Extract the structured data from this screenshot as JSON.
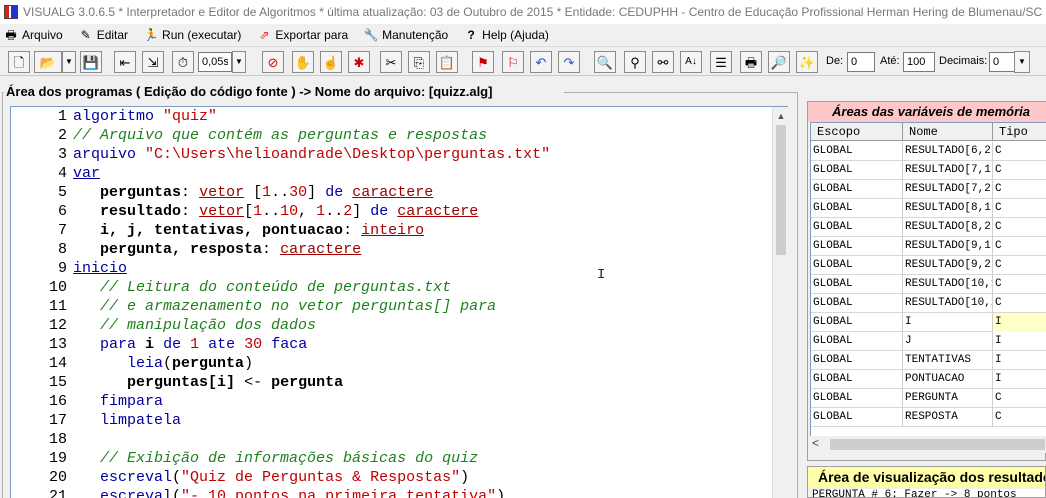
{
  "window": {
    "title": "VISUALG 3.0.6.5 * Interpretador e Editor de Algoritmos * última atualização: 03 de Outubro de 2015 * Entidade: CEDUPHH - Centro de Educação Profissional Herman Hering de Blumenau/SC"
  },
  "menu": [
    {
      "label": "Arquivo",
      "icon": "printer-icon"
    },
    {
      "label": "Editar",
      "icon": "pencil-icon"
    },
    {
      "label": "Run (executar)",
      "icon": "runner-icon"
    },
    {
      "label": "Exportar para",
      "icon": "export-icon"
    },
    {
      "label": "Manutenção",
      "icon": "wrench-icon"
    },
    {
      "label": "Help (Ajuda)",
      "icon": "question-icon"
    }
  ],
  "toolbar": {
    "speed_value": "0,05s",
    "de_label": "De:",
    "de_value": "0",
    "ate_label": "Até:",
    "ate_value": "100",
    "decimais_label": "Decimais:",
    "decimais_value": "0"
  },
  "editor": {
    "header": "Área dos programas ( Edição do código fonte ) -> Nome do arquivo: [quizz.alg]"
  },
  "variables": {
    "title": "Áreas das variáveis de memória",
    "columns": [
      "Escopo",
      "Nome",
      "Tipo"
    ],
    "rows": [
      [
        "GLOBAL",
        "RESULTADO[6,2]",
        "C"
      ],
      [
        "GLOBAL",
        "RESULTADO[7,1]",
        "C"
      ],
      [
        "GLOBAL",
        "RESULTADO[7,2]",
        "C"
      ],
      [
        "GLOBAL",
        "RESULTADO[8,1]",
        "C"
      ],
      [
        "GLOBAL",
        "RESULTADO[8,2]",
        "C"
      ],
      [
        "GLOBAL",
        "RESULTADO[9,1]",
        "C"
      ],
      [
        "GLOBAL",
        "RESULTADO[9,2]",
        "C"
      ],
      [
        "GLOBAL",
        "RESULTADO[10,1]",
        "C"
      ],
      [
        "GLOBAL",
        "RESULTADO[10,2]",
        "C"
      ],
      [
        "GLOBAL",
        "I",
        "I"
      ],
      [
        "GLOBAL",
        "J",
        "I"
      ],
      [
        "GLOBAL",
        "TENTATIVAS",
        "I"
      ],
      [
        "GLOBAL",
        "PONTUACAO",
        "I"
      ],
      [
        "GLOBAL",
        "PERGUNTA",
        "C"
      ],
      [
        "GLOBAL",
        "RESPOSTA",
        "C"
      ]
    ]
  },
  "output": {
    "title": "Área de visualização dos resultados",
    "text": "PERGUNTA # 6: Fazer -> 8 pontos"
  },
  "colors": {
    "keyword": "#0000a0",
    "string": "#c00000",
    "comment": "#208020",
    "var_title_bg": "#ffc8c8",
    "out_title_bg": "#ffffa8"
  }
}
